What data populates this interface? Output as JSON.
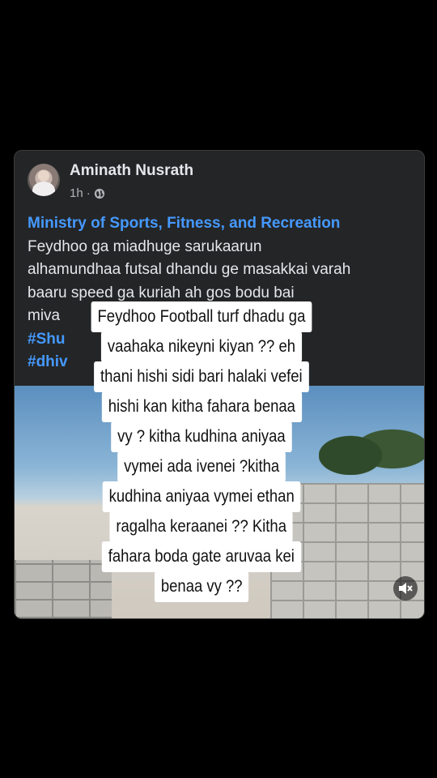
{
  "post": {
    "author": "Aminath Nusrath",
    "time": "1h",
    "separator": "·",
    "audience_icon": "globe-icon",
    "link_text": "Ministry of Sports, Fitness, and Recreation",
    "body_lines": [
      "Feydhoo ga miadhuge sarukaarun",
      "alhamundhaa futsal dhandu ge masakkai varah",
      "baaru speed ga kuriah ah gos bodu bai",
      "miva"
    ],
    "hashtags": [
      "#Shu",
      "#dhiv"
    ]
  },
  "media": {
    "mute_icon": "speaker-muted-icon"
  },
  "overlay_caption": {
    "lines": [
      "Feydhoo Football turf dhadu ga",
      "vaahaka nikeyni kiyan ??  eh",
      "thani hishi sidi bari halaki vefei",
      "hishi kan kitha fahara benaa",
      "vy  ? kitha kudhina aniyaa",
      "vymei ada ivenei ?kitha",
      "kudhina aniyaa vymei ethan",
      "ragalha keraanei ?? Kitha",
      "fahara boda gate aruvaa kei",
      "benaa vy ??"
    ]
  },
  "colors": {
    "card_bg": "#242526",
    "link_blue": "#4599ff",
    "text": "#e4e6eb",
    "secondary_text": "#b0b3b8"
  }
}
